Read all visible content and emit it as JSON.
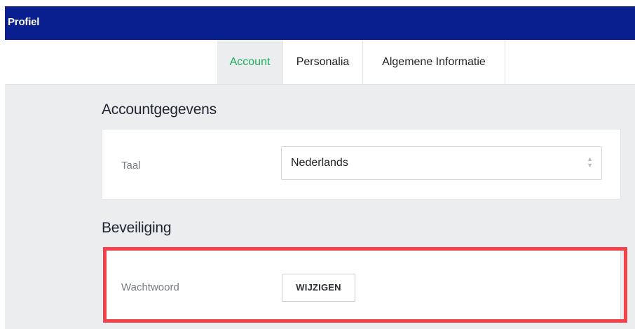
{
  "header": {
    "title": "Profiel"
  },
  "tabs": [
    {
      "label": "Account",
      "active": true
    },
    {
      "label": "Personalia",
      "active": false
    },
    {
      "label": "Algemene Informatie",
      "active": false
    }
  ],
  "account_section": {
    "title": "Accountgegevens",
    "language_label": "Taal",
    "language_value": "Nederlands"
  },
  "security_section": {
    "title": "Beveiliging",
    "password_label": "Wachtwoord",
    "change_button": "WIJZIGEN"
  },
  "colors": {
    "header_bg": "#0a1f8f",
    "active_tab_text": "#1fae5a",
    "highlight": "#f2434a"
  },
  "icons": {
    "select_arrows": "up-down-arrows-icon"
  }
}
